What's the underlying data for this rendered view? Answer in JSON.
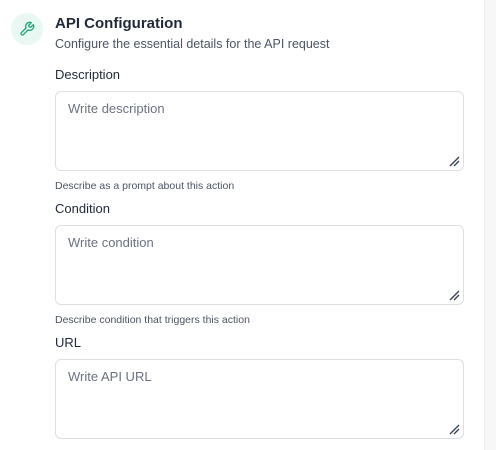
{
  "header": {
    "icon": "wrench-icon",
    "title": "API Configuration",
    "subtitle": "Configure the essential details for the API request",
    "accent_color": "#1fa57a",
    "icon_bg": "#e9f8f3"
  },
  "fields": [
    {
      "label": "Description",
      "placeholder": "Write description",
      "value": "",
      "hint": "Describe as a prompt about this action"
    },
    {
      "label": "Condition",
      "placeholder": "Write condition",
      "value": "",
      "hint": "Describe condition that triggers this action"
    },
    {
      "label": "URL",
      "placeholder": "Write API URL",
      "value": ""
    }
  ]
}
